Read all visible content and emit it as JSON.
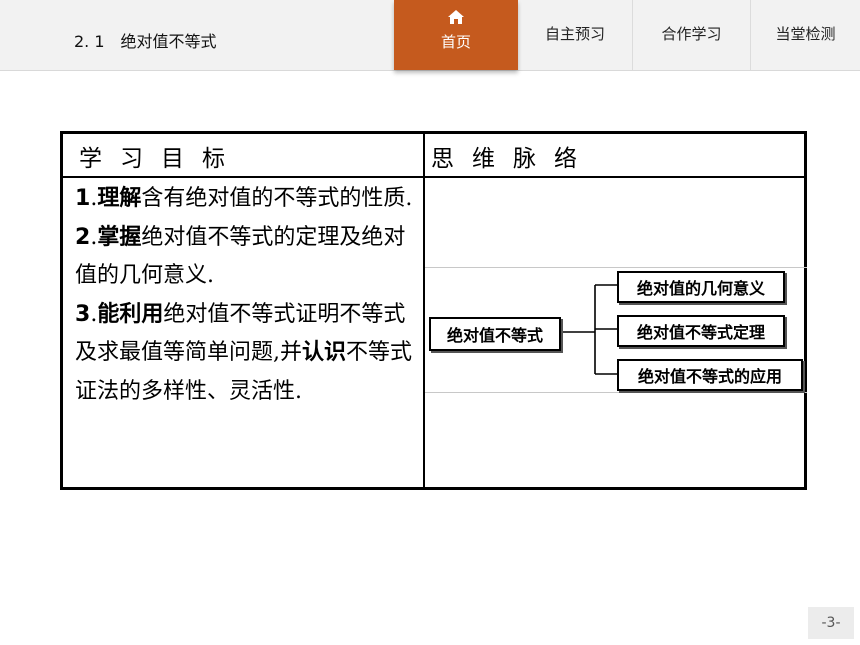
{
  "header": {
    "section_number": "2. 1",
    "section_title": "绝对值不等式",
    "nav": {
      "home_label": "首页",
      "items": [
        "自主预习",
        "合作学习",
        "当堂检测"
      ]
    }
  },
  "table": {
    "left_header": "学习目标",
    "right_header": "思维脉络",
    "goals": [
      {
        "num": "1",
        "verb": "理解",
        "text": "含有绝对值的不等式的性质."
      },
      {
        "num": "2",
        "verb": "掌握",
        "text": "绝对值不等式的定理及绝对值的几何意义."
      },
      {
        "num": "3",
        "verb": "能利用",
        "text": "绝对值不等式证明不等式及求最值等简单问题,并",
        "verb2": "认识",
        "text2": "不等式证法的多样性、灵活性."
      }
    ],
    "mindmap": {
      "root": "绝对值不等式",
      "children": [
        "绝对值的几何意义",
        "绝对值不等式定理",
        "绝对值不等式的应用"
      ]
    }
  },
  "footer": {
    "page_number": "-3-"
  },
  "colors": {
    "accent": "#c55a1e",
    "header_bg": "#f2f2f2"
  }
}
